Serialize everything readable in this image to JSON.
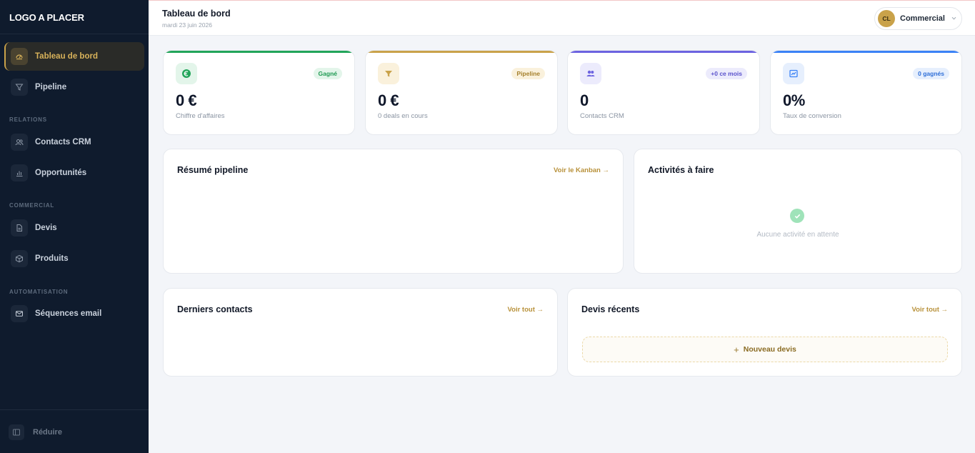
{
  "sidebar": {
    "logo": "LOGO A PLACER",
    "items": {
      "dashboard": "Tableau de bord",
      "pipeline": "Pipeline",
      "contacts": "Contacts CRM",
      "opportunities": "Opportunités",
      "quotes": "Devis",
      "products": "Produits",
      "sequences": "Séquences email"
    },
    "sections": {
      "relations": "RELATIONS",
      "commercial": "COMMERCIAL",
      "automation": "AUTOMATISATION"
    },
    "collapse_label": "Réduire"
  },
  "header": {
    "title": "Tableau de bord",
    "date": "mardi 23 juin 2026",
    "user_initials": "CL",
    "user_role": "Commercial"
  },
  "stats": [
    {
      "badge": "Gagné",
      "value": "0 €",
      "label": "Chiffre d'affaires",
      "color": "#22a55a",
      "icon": "euro-icon"
    },
    {
      "badge": "Pipeline",
      "value": "0 €",
      "label": "0 deals en cours",
      "color": "#c9a24a",
      "icon": "funnel-icon"
    },
    {
      "badge": "+0 ce mois",
      "value": "0",
      "label": "Contacts CRM",
      "color": "#6c63e0",
      "icon": "users-icon"
    },
    {
      "badge": "0 gagnés",
      "value": "0%",
      "label": "Taux de conversion",
      "color": "#3b82f6",
      "icon": "chart-icon"
    }
  ],
  "pipeline_summary": {
    "title": "Résumé pipeline",
    "link": "Voir le Kanban →"
  },
  "activities": {
    "title": "Activités à faire",
    "empty": "Aucune activité en attente"
  },
  "recent_contacts": {
    "title": "Derniers contacts",
    "link": "Voir tout →"
  },
  "recent_quotes": {
    "title": "Devis récents",
    "link": "Voir tout →",
    "new_button": "Nouveau devis"
  },
  "colors": {
    "sidebar_bg": "#0f1b2d",
    "accent": "#c9a24a",
    "page_bg": "#f3f5f9"
  }
}
